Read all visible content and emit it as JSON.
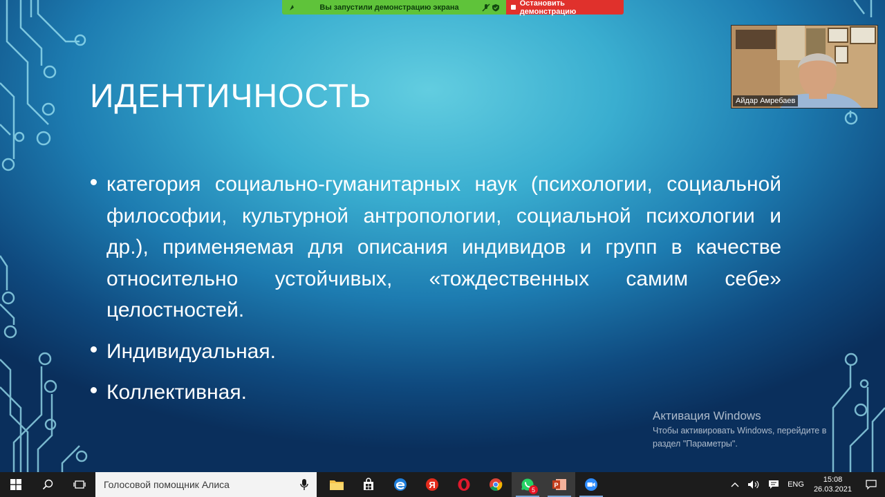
{
  "share_bar": {
    "status_text": "Вы запустили демонстрацию экрана",
    "stop_label": "Остановить демонстрацию"
  },
  "video": {
    "participant_name": "Айдар Амребаев"
  },
  "slide": {
    "title": "ИДЕНТИЧНОСТЬ",
    "bullets": [
      "категория социально-гуманитарных наук (психологии, социальной философии, культурной антропологии, социальной психологии и др.), применяемая для описания индивидов и групп в качестве относительно устойчивых, «тождественных самим себе» целостностей.",
      "Индивидуальная.",
      "Коллективная."
    ]
  },
  "watermark": {
    "title": "Активация Windows",
    "line1": "Чтобы активировать Windows, перейдите в",
    "line2": "раздел \"Параметры\"."
  },
  "taskbar": {
    "search_placeholder": "Голосовой помощник Алиса",
    "apps": [
      "file-explorer",
      "store",
      "edge",
      "yandex-browser",
      "opera",
      "chrome",
      "whatsapp",
      "powerpoint",
      "zoom"
    ],
    "whatsapp_badge": "5",
    "language": "ENG",
    "time": "15:08",
    "date": "26.03.2021"
  },
  "colors": {
    "share_green": "#5fc33a",
    "stop_red": "#e0312c",
    "slide_accent": "#3aaed0",
    "taskbar": "#1c1c1c"
  }
}
